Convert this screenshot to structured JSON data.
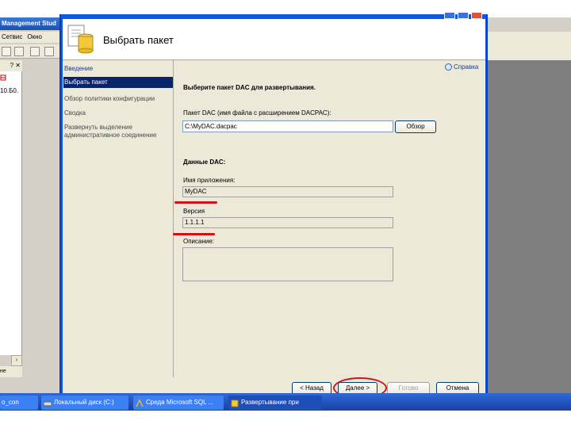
{
  "background_window": {
    "title": "Management Stud",
    "menu": [
      "Сетвис",
      "Окно"
    ],
    "panel_controls": "? ✕",
    "tree_text": "10.Б0.",
    "bottom_text": "не"
  },
  "dialog": {
    "title": "Выбрать пакет",
    "help_label": "Справка",
    "nav_items": [
      "Введение",
      "Выбрать пакет",
      "Обзор политики конфигурации",
      "Сводка",
      "Развернуть выделение\nадминистративное соединение"
    ],
    "instruction": "Выберите пакет DAC для развертывания.",
    "package_label": "Пакет DAC (имя файла с расширением DACPAC):",
    "package_path": "C:\\MyDAC.dacpac",
    "browse_label": "Обзор",
    "dac_heading": "Данные DAC:",
    "app_name_label": "Имя приложения:",
    "app_name_value": "MyDAC",
    "version_label": "Версия",
    "version_value": "1.1.1.1",
    "description_label": "Описание:",
    "description_value": "",
    "buttons": {
      "back": "< Назад",
      "next": "Далее >",
      "finish": "Готово",
      "cancel": "Отмена"
    }
  },
  "taskbar": {
    "items": [
      "o_con",
      "Локальный диск (C:)",
      "Среда Microsoft SQL ...",
      "Развертывание при"
    ]
  },
  "annotation_color": "#d0121b"
}
